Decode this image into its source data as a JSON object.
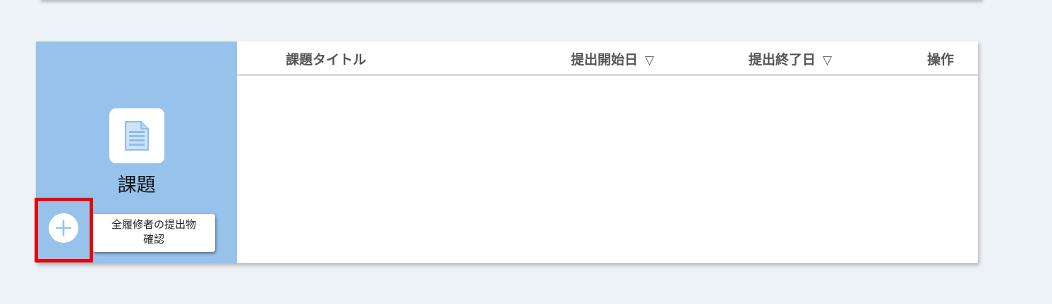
{
  "side_panel": {
    "title": "課題",
    "icon": "document-icon",
    "add_button_icon": "plus-icon",
    "tooltip_line1": "全履修者の提出物",
    "tooltip_line2": "確認"
  },
  "table": {
    "columns": {
      "title": "課題タイトル",
      "start_date": "提出開始日",
      "end_date": "提出終了日",
      "actions": "操作"
    },
    "sort_icon": "▽",
    "rows": []
  },
  "colors": {
    "page_background": "#edf2f7",
    "side_panel": "#96c2ec",
    "highlight_border": "#ee0000",
    "header_text": "#555555"
  }
}
